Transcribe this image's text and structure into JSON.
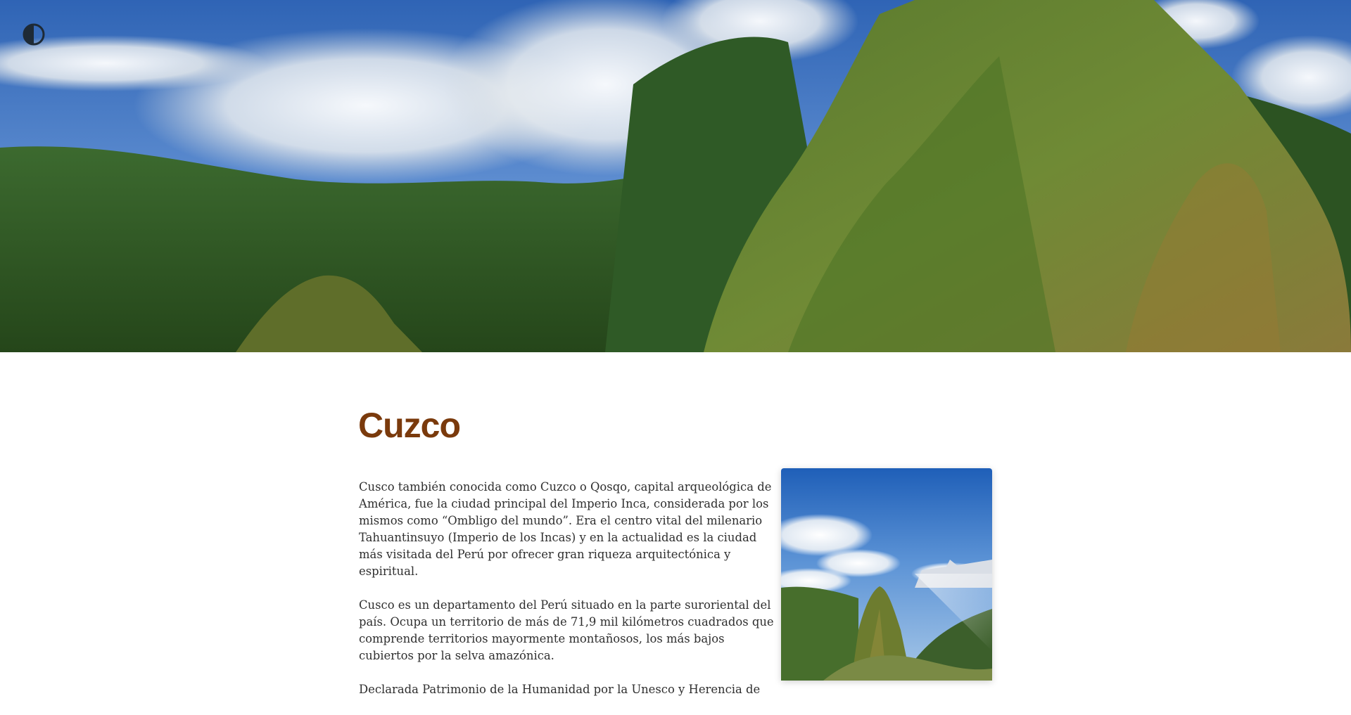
{
  "header": {
    "theme_toggle_icon": "contrast-icon"
  },
  "hero": {
    "image": "mountain-landscape-hero"
  },
  "article": {
    "title": "Cuzco",
    "paragraphs": [
      "Cusco también conocida como Cuzco o Qosqo, capital arqueológica de América, fue la ciudad principal del Imperio Inca, considerada por los mismos como “Ombligo del mundo”. Era el centro vital del milenario Tahuantinsuyo (Imperio de los Incas) y en la actualidad es la ciudad más visitada del Perú por ofrecer gran riqueza arquitectónica y espiritual.",
      "Cusco es un departamento del Perú situado en la parte suroriental del país. Ocupa un territorio de más de 71,9 mil kilómetros cuadrados que comprende territorios mayormente montañosos, los más bajos cubiertos por la selva amazónica.",
      "Declarada Patrimonio de la Humanidad por la Unesco y Herencia de"
    ],
    "side_image": "machu-picchu-photo"
  },
  "colors": {
    "title": "#7a3a0c",
    "text": "#2f2f2f",
    "background": "#ffffff"
  }
}
